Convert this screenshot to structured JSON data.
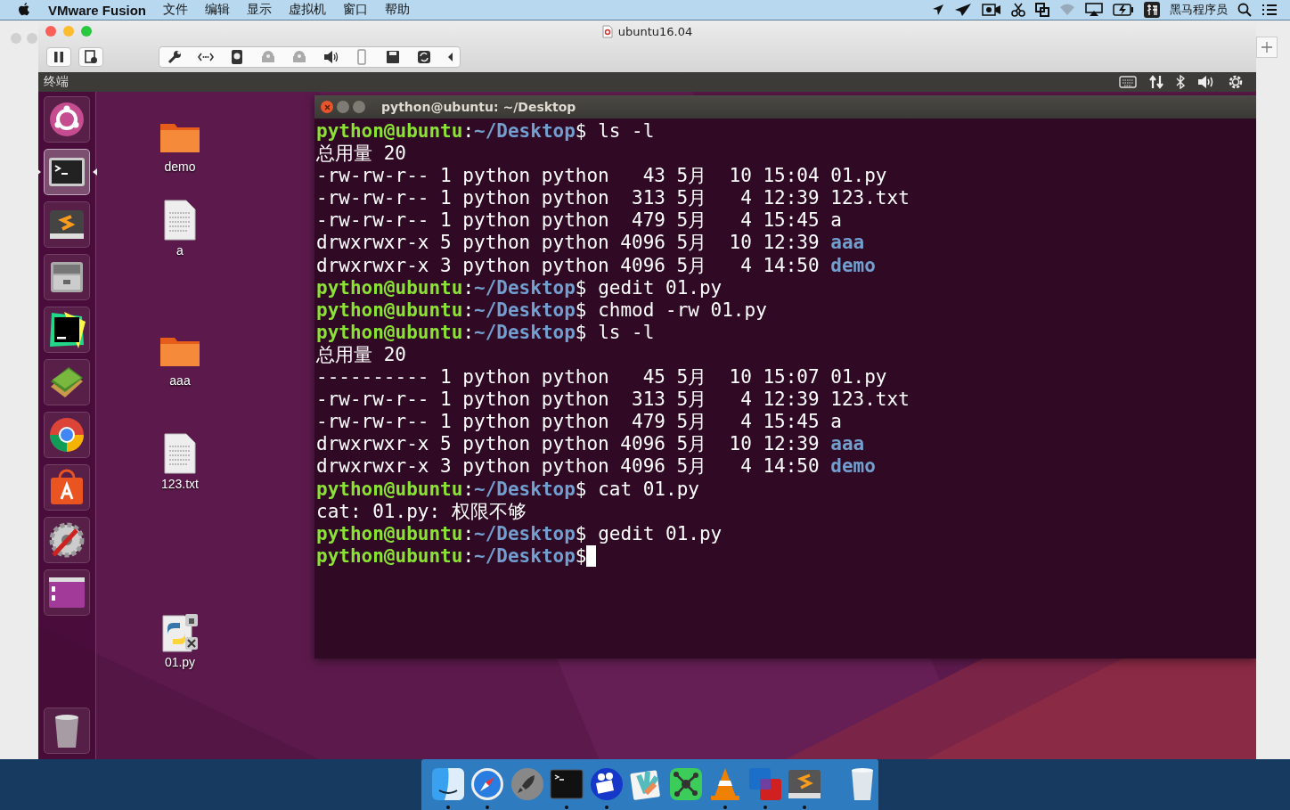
{
  "menu_bar": {
    "app": "VMware Fusion",
    "menus": [
      "文件",
      "编辑",
      "显示",
      "虚拟机",
      "窗口",
      "帮助"
    ],
    "user": "黑马程序员"
  },
  "vm_window": {
    "title": "ubuntu16.04"
  },
  "ubuntu_panel": {
    "title": "终端"
  },
  "launcher": [
    {
      "kind": "dash",
      "selected": false
    },
    {
      "kind": "terminal",
      "selected": true
    },
    {
      "kind": "sublime",
      "selected": false
    },
    {
      "kind": "files",
      "selected": false
    },
    {
      "kind": "pycharm",
      "selected": false
    },
    {
      "kind": "books",
      "selected": false
    },
    {
      "kind": "chrome",
      "selected": false
    },
    {
      "kind": "store",
      "selected": false
    },
    {
      "kind": "settings",
      "selected": false
    },
    {
      "kind": "workspaces",
      "selected": false
    },
    {
      "kind": "trash",
      "selected": false
    }
  ],
  "desktop_icons": [
    {
      "label": "demo",
      "kind": "folder"
    },
    {
      "label": "a",
      "kind": "file"
    },
    {
      "label": "aaa",
      "kind": "folder"
    },
    {
      "label": "123.txt",
      "kind": "file"
    },
    {
      "label": "01.py",
      "kind": "python"
    }
  ],
  "terminal": {
    "title": "python@ubuntu: ~/Desktop",
    "lines": [
      {
        "kind": "prompt",
        "user": "python@ubuntu",
        "sep": ":",
        "path": "~/Desktop",
        "symbol": "$",
        "command": " ls -l"
      },
      {
        "kind": "output",
        "text": "总用量 20"
      },
      {
        "kind": "entry",
        "text": "-rw-rw-r-- 1 python python   43 5月  10 15:04 ",
        "name": "01.py",
        "dir": false
      },
      {
        "kind": "entry",
        "text": "-rw-rw-r-- 1 python python  313 5月   4 12:39 ",
        "name": "123.txt",
        "dir": false
      },
      {
        "kind": "entry",
        "text": "-rw-rw-r-- 1 python python  479 5月   4 15:45 ",
        "name": "a",
        "dir": false
      },
      {
        "kind": "entry",
        "text": "drwxrwxr-x 5 python python 4096 5月  10 12:39 ",
        "name": "aaa",
        "dir": true
      },
      {
        "kind": "entry",
        "text": "drwxrwxr-x 3 python python 4096 5月   4 14:50 ",
        "name": "demo",
        "dir": true
      },
      {
        "kind": "prompt",
        "user": "python@ubuntu",
        "sep": ":",
        "path": "~/Desktop",
        "symbol": "$",
        "command": " gedit 01.py"
      },
      {
        "kind": "prompt",
        "user": "python@ubuntu",
        "sep": ":",
        "path": "~/Desktop",
        "symbol": "$",
        "command": " chmod -rw 01.py"
      },
      {
        "kind": "prompt",
        "user": "python@ubuntu",
        "sep": ":",
        "path": "~/Desktop",
        "symbol": "$",
        "command": " ls -l"
      },
      {
        "kind": "output",
        "text": "总用量 20"
      },
      {
        "kind": "entry",
        "text": "---------- 1 python python   45 5月  10 15:07 ",
        "name": "01.py",
        "dir": false
      },
      {
        "kind": "entry",
        "text": "-rw-rw-r-- 1 python python  313 5月   4 12:39 ",
        "name": "123.txt",
        "dir": false
      },
      {
        "kind": "entry",
        "text": "-rw-rw-r-- 1 python python  479 5月   4 15:45 ",
        "name": "a",
        "dir": false
      },
      {
        "kind": "entry",
        "text": "drwxrwxr-x 5 python python 4096 5月  10 12:39 ",
        "name": "aaa",
        "dir": true
      },
      {
        "kind": "entry",
        "text": "drwxrwxr-x 3 python python 4096 5月   4 14:50 ",
        "name": "demo",
        "dir": true
      },
      {
        "kind": "prompt",
        "user": "python@ubuntu",
        "sep": ":",
        "path": "~/Desktop",
        "symbol": "$",
        "command": " cat 01.py"
      },
      {
        "kind": "output",
        "text": "cat: 01.py: 权限不够"
      },
      {
        "kind": "prompt",
        "user": "python@ubuntu",
        "sep": ":",
        "path": "~/Desktop",
        "symbol": "$",
        "command": " gedit 01.py"
      },
      {
        "kind": "prompt",
        "user": "python@ubuntu",
        "sep": ":",
        "path": "~/Desktop",
        "symbol": "$",
        "cursor": true
      }
    ]
  },
  "dock": [
    {
      "kind": "finder",
      "running": true
    },
    {
      "kind": "safari",
      "running": true
    },
    {
      "kind": "launchpad",
      "running": false
    },
    {
      "kind": "terminal",
      "running": true
    },
    {
      "kind": "video",
      "running": true
    },
    {
      "kind": "notes",
      "running": false
    },
    {
      "kind": "mindmap",
      "running": false
    },
    {
      "kind": "vlc",
      "running": true
    },
    {
      "kind": "vmware",
      "running": true
    },
    {
      "kind": "sublime",
      "running": true
    },
    {
      "kind": "trash",
      "running": false
    }
  ]
}
